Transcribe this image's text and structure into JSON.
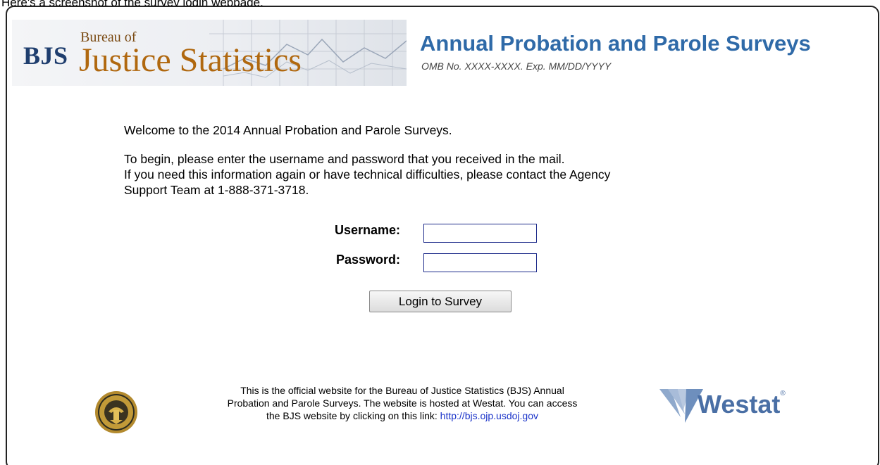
{
  "caption": "Here's a screenshot of the survey login webpage.",
  "header": {
    "bjs_abbr": "BJS",
    "bureau_of": "Bureau of",
    "justice_statistics": "Justice Statistics",
    "site_title": "Annual Probation and Parole Surveys",
    "omb": "OMB No. XXXX-XXXX. Exp. MM/DD/YYYY"
  },
  "main": {
    "welcome": "Welcome to the 2014 Annual Probation and Parole Surveys.",
    "intro_line1": "To begin, please enter the username and password that you received in the mail.",
    "intro_line2": "If you need this information again or have technical difficulties, please contact the Agency",
    "intro_line3": "Support Team at 1-888-371-3718."
  },
  "login_form": {
    "username_label": "Username:",
    "username_value": "",
    "password_label": "Password:",
    "password_value": "",
    "submit_label": "Login to Survey"
  },
  "footer": {
    "text_line1": "This is the official website for the Bureau of Justice Statistics (BJS) Annual",
    "text_line2": "Probation and Parole Surveys. The website is hosted at Westat. You can access",
    "text_line3_prefix": "the BJS website by clicking on this link: ",
    "link_text": "http://bjs.ojp.usdoj.gov",
    "westat_name": "Westat",
    "westat_mark": "®"
  },
  "icons": {
    "seal": "doj-seal-icon",
    "westat": "westat-logo-icon"
  },
  "colors": {
    "title_blue": "#2f6aa8",
    "bjs_navy": "#1f3e6e",
    "justice_orange": "#b0680f",
    "link_blue": "#1a33c9",
    "westat_blue": "#4a6fa5"
  }
}
